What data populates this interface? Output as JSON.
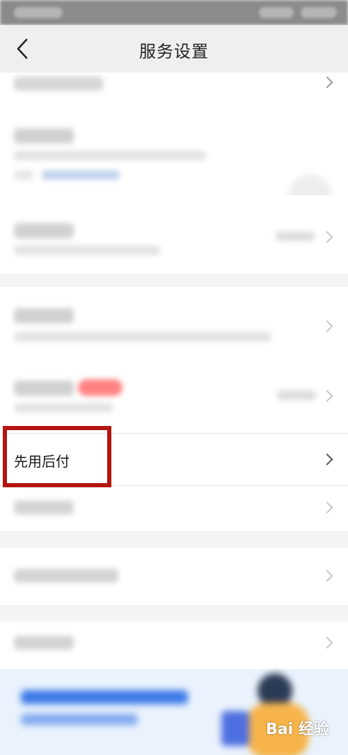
{
  "header": {
    "title": "服务设置"
  },
  "items": {
    "pay_later_label": "先用后付"
  },
  "watermark": {
    "text": "Bai 经验"
  },
  "colors": {
    "highlight": "#b3150f",
    "banner_bg": "#eaf3fd",
    "badge": "#ff6d6d"
  }
}
